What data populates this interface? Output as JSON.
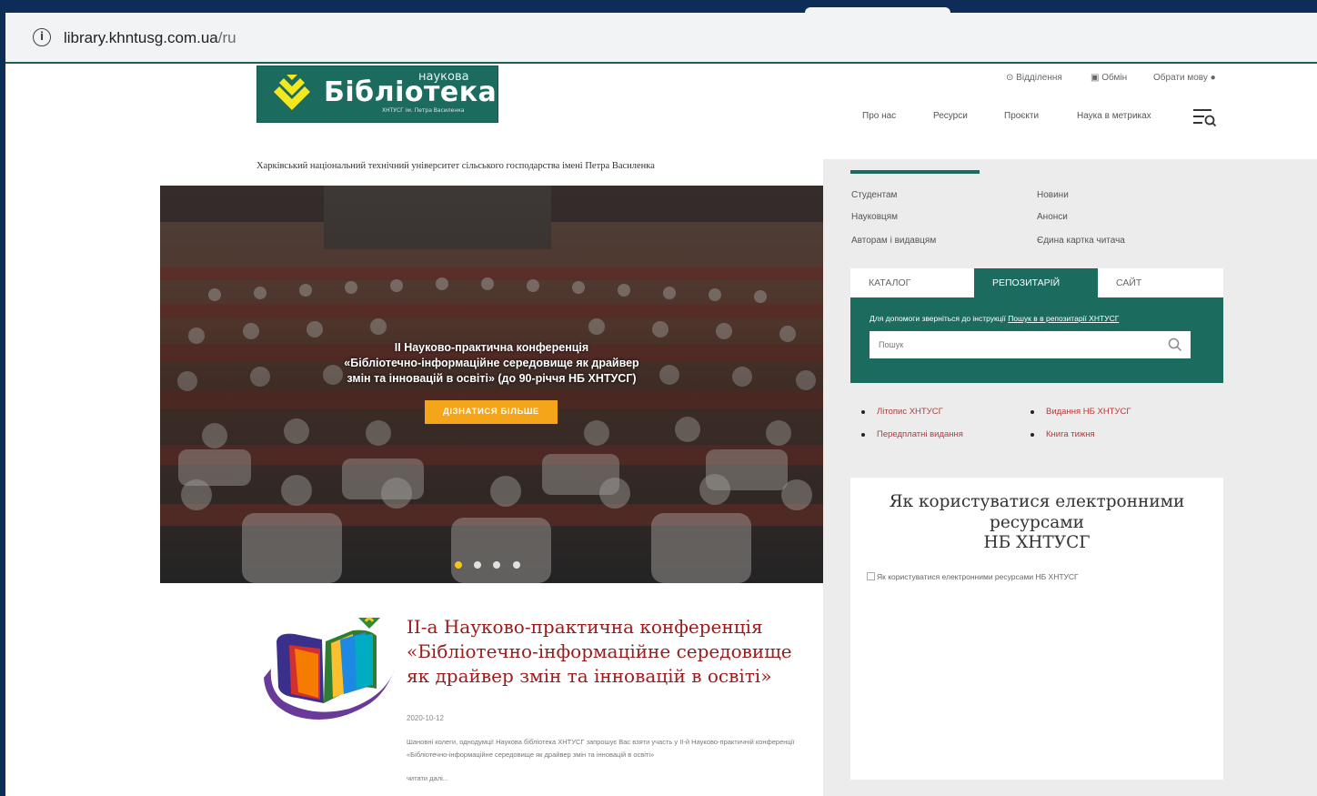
{
  "browser": {
    "url_host": "library.khntusg.com.ua",
    "url_path": "/ru"
  },
  "logo": {
    "top_word": "наукова",
    "title": "Бібліотека",
    "subtitle": "ХНТУСГ ім. Петра Василенка"
  },
  "header": {
    "util_links": [
      {
        "label": "Відділення",
        "icon": "location-pin-icon"
      },
      {
        "label": "Обмін",
        "icon": "gift-icon"
      },
      {
        "label": "Обрати мову",
        "icon": "globe-icon"
      }
    ],
    "nav": [
      "Про нас",
      "Ресурси",
      "Проєкти",
      "Наука в метриках"
    ]
  },
  "university_name": "Харківський національний технічний університет сільського господарства імені Петра Василенка",
  "hero": {
    "line1": "II Науково-практична конференція",
    "line2": "«Бібліотечно-інформаційне середовище як драйвер",
    "line3": "змін та інновацій в освіті» (до 90-річчя НБ ХНТУСГ)",
    "button": "ДІЗНАТИСЯ БІЛЬШЕ",
    "slides_total": 4,
    "slide_active": 1
  },
  "news": {
    "title": "II-а Науково-практична конференція «Бібліотечно-інформаційне середовище як драйвер змін та інновацій в освіті»",
    "date": "2020-10-12",
    "desc": "Шановні колеги, однодумці! Наукова бібліотека ХНТУСГ запрошує Вас взяти участь у II-й Науково-практичній конференції «Бібліотечно-інформаційне середовище як драйвер змін та інновацій в освіті»",
    "more": "читати далі..."
  },
  "sidebar": {
    "links_left": [
      "Студентам",
      "Науковцям",
      "Авторам і видавцям"
    ],
    "links_right": [
      "Новини",
      "Анонси",
      "Єдина картка читача"
    ],
    "tabs": [
      "КАТАЛОГ",
      "РЕПОЗИТАРІЙ",
      "САЙТ"
    ],
    "active_tab": "РЕПОЗИТАРІЙ",
    "hint_text": "Для допомоги зверніться до інструкції ",
    "hint_link": "Пошук в в репозитарії ХНТУСГ",
    "search_placeholder": "Пошук",
    "resources_left": [
      "Літопис ХНТУСГ",
      "Передплатні видання"
    ],
    "resources_right": [
      "Видання НБ ХНТУСГ",
      "Книга тижня"
    ],
    "how_title_1": "Як користуватися електронними",
    "how_title_2": "ресурсами",
    "how_title_3": "НБ ХНТУСГ",
    "how_img_alt": "Як користуватися електронними ресурсами НБ ХНТУСГ"
  },
  "colors": {
    "brand_green": "#1b6b5e",
    "accent_yellow": "#f5a51a",
    "news_red": "#9b1b1b"
  }
}
